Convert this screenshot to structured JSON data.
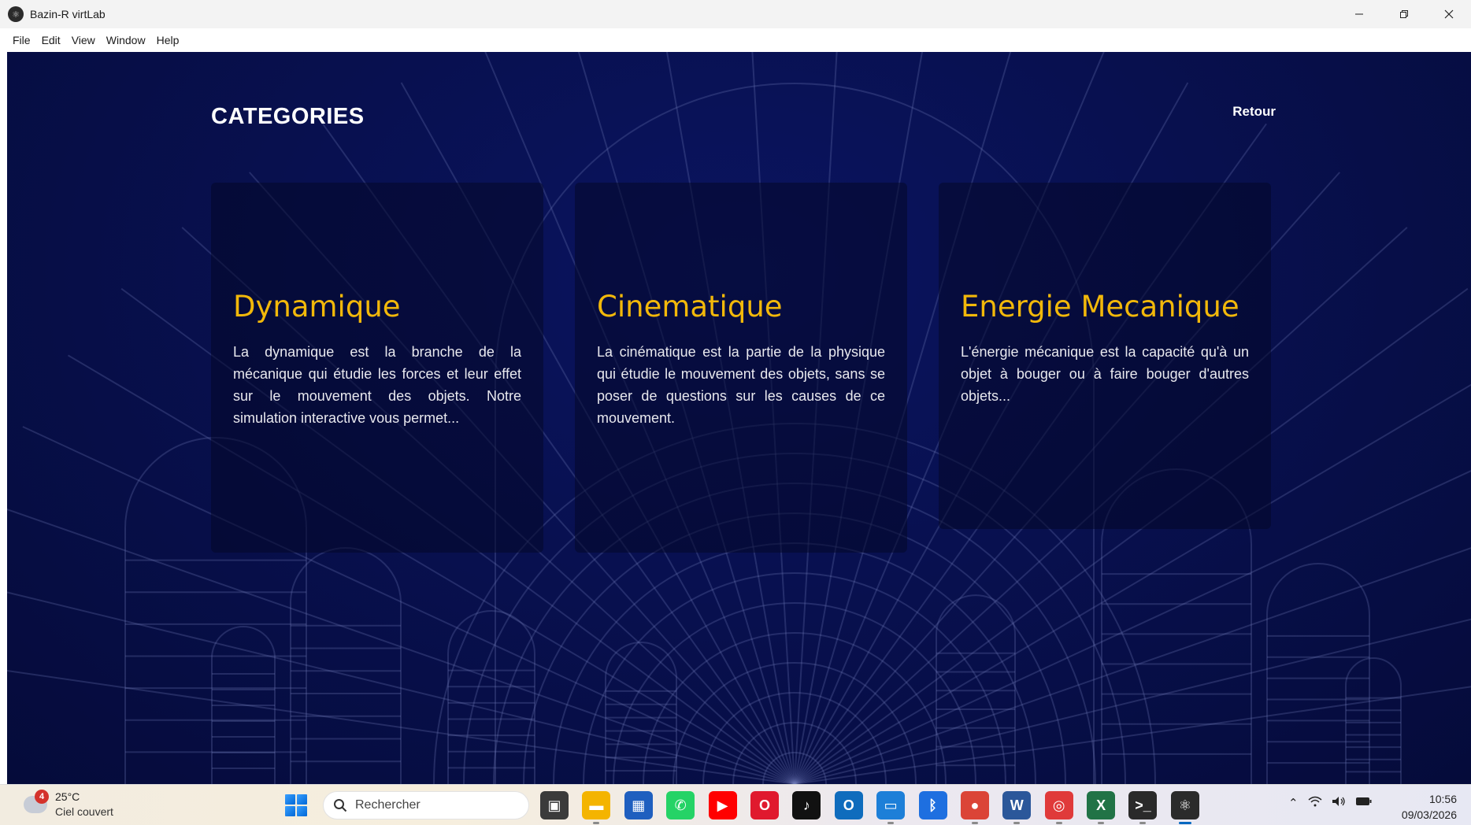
{
  "window": {
    "title": "Bazin-R virtLab",
    "controls": [
      "minimize-icon",
      "restore-icon",
      "close-icon"
    ]
  },
  "menu": [
    "File",
    "Edit",
    "View",
    "Window",
    "Help"
  ],
  "page": {
    "title": "CATEGORIES",
    "back_label": "Retour"
  },
  "cards": [
    {
      "title": "Dynamique",
      "description": "La dynamique est la branche de la mécanique qui étudie les forces et leur effet sur le mouvement des objets. Notre simulation interactive vous permet..."
    },
    {
      "title": "Cinematique",
      "description": "La cinématique est la partie de la physique qui étudie le mouvement des objets, sans se poser de questions sur les causes de ce mouvement."
    },
    {
      "title": "Energie Mecanique",
      "description": "L'énergie mécanique est la capacité qu'à un objet à bouger ou à faire bouger d'autres objets..."
    }
  ],
  "taskbar": {
    "weather": {
      "badge": "4",
      "temperature": "25°C",
      "condition": "Ciel couvert"
    },
    "search_label": "Rechercher",
    "apps": [
      {
        "name": "task-view-icon",
        "color": "#3b3b3b"
      },
      {
        "name": "file-explorer-icon",
        "color": "#f4b400"
      },
      {
        "name": "microsoft-store-icon",
        "color": "#1f5fbf"
      },
      {
        "name": "whatsapp-icon",
        "color": "#25d366"
      },
      {
        "name": "youtube-icon",
        "color": "#ff0000"
      },
      {
        "name": "opera-icon",
        "color": "#e0192e"
      },
      {
        "name": "tiktok-icon",
        "color": "#111111"
      },
      {
        "name": "outlook-icon",
        "color": "#0f6cbd"
      },
      {
        "name": "remote-desktop-icon",
        "color": "#1d7fd8"
      },
      {
        "name": "bluetooth-icon",
        "color": "#1e6fe0"
      },
      {
        "name": "chrome-icon",
        "color": "#db4437"
      },
      {
        "name": "word-icon",
        "color": "#2b579a"
      },
      {
        "name": "app-icon",
        "color": "#e03a3a"
      },
      {
        "name": "excel-icon",
        "color": "#217346"
      },
      {
        "name": "terminal-icon",
        "color": "#2a2a2a"
      },
      {
        "name": "virtlab-icon",
        "color": "#2b2b2b"
      }
    ],
    "systray": [
      "chevron-up-icon",
      "wifi-icon",
      "volume-icon",
      "battery-icon"
    ],
    "time": "10:56",
    "date": "09/03/2026"
  }
}
